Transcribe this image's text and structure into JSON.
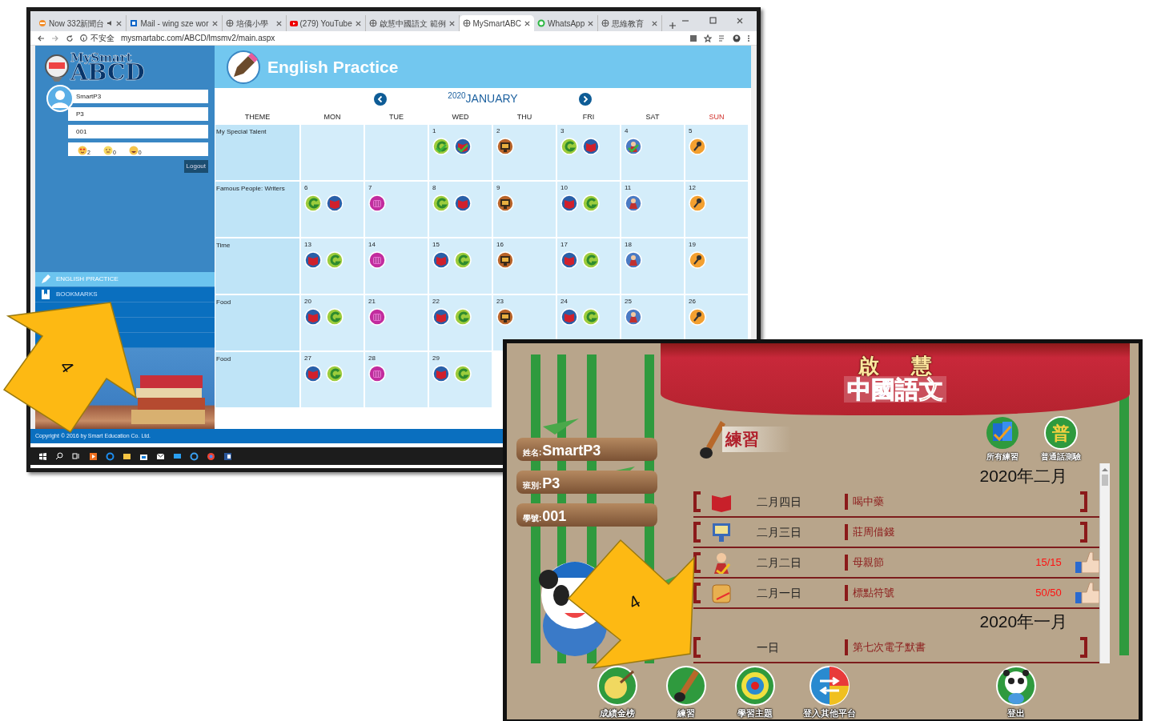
{
  "browser": {
    "tabs": [
      {
        "title": "Now 332新聞台",
        "kind": "news",
        "audio": true,
        "selected": false
      },
      {
        "title": "Mail - wing sze wor",
        "kind": "mail",
        "audio": false,
        "selected": false
      },
      {
        "title": "培僑小學",
        "kind": "globe",
        "audio": false,
        "selected": false
      },
      {
        "title": "(279) YouTube",
        "kind": "play",
        "audio": false,
        "selected": false
      },
      {
        "title": "啟慧中國語文 範例",
        "kind": "globe",
        "audio": false,
        "selected": false
      },
      {
        "title": "MySmartABC",
        "kind": "globe",
        "audio": false,
        "selected": true
      },
      {
        "title": "WhatsApp",
        "kind": "chat",
        "audio": false,
        "selected": false
      },
      {
        "title": "思維教育",
        "kind": "globe",
        "audio": false,
        "selected": false
      }
    ],
    "security": "不安全",
    "url": "mysmartabc.com/ABCD/lmsmv2/main.aspx"
  },
  "sidebar": {
    "logo": {
      "line1": "MySmart",
      "line2": "ABCD"
    },
    "fields": [
      "SmartP3",
      "P3",
      "001"
    ],
    "reactions": [
      {
        "kind": "love",
        "count": "2"
      },
      {
        "kind": "smile",
        "count": "0"
      },
      {
        "kind": "grin",
        "count": "0"
      }
    ],
    "logout": "Logout",
    "menu": [
      {
        "label": "ENGLISH PRACTICE",
        "kind": "pencil",
        "selected": true
      },
      {
        "label": "BOOKMARKS",
        "kind": "bookmark",
        "selected": false
      }
    ],
    "copyright": "Copyright © 2016 by Smart Education Co. Ltd."
  },
  "header": {
    "title": "English Practice"
  },
  "calendar": {
    "year": "2020",
    "month": "JANUARY",
    "columns": [
      {
        "label": "THEME",
        "highlighted": false
      },
      {
        "label": "MON",
        "highlighted": false
      },
      {
        "label": "TUE",
        "highlighted": false
      },
      {
        "label": "WED",
        "highlighted": false
      },
      {
        "label": "THU",
        "highlighted": false
      },
      {
        "label": "FRI",
        "highlighted": false
      },
      {
        "label": "SAT",
        "highlighted": false
      },
      {
        "label": "SUN",
        "highlighted": true
      }
    ],
    "rows": [
      {
        "theme": "My Special Talent",
        "days": [
          {
            "kind": "empty"
          },
          {
            "kind": "empty"
          },
          {
            "day": "1",
            "icons": [
              {
                "kind": "g",
                "done": true
              },
              {
                "kind": "book",
                "done": true
              }
            ]
          },
          {
            "day": "2",
            "icons": [
              {
                "kind": "monitor",
                "done": false
              }
            ]
          },
          {
            "day": "3",
            "icons": [
              {
                "kind": "g",
                "done": false
              },
              {
                "kind": "book",
                "done": false
              }
            ]
          },
          {
            "day": "4",
            "icons": [
              {
                "kind": "figure",
                "done": true
              }
            ]
          },
          {
            "day": "5",
            "icons": [
              {
                "kind": "key",
                "done": false
              }
            ]
          }
        ]
      },
      {
        "theme": "Famous People: Writers",
        "days": [
          {
            "day": "6",
            "icons": [
              {
                "kind": "g",
                "done": false
              },
              {
                "kind": "book",
                "done": false
              }
            ]
          },
          {
            "day": "7",
            "icons": [
              {
                "kind": "drum",
                "done": false
              }
            ]
          },
          {
            "day": "8",
            "icons": [
              {
                "kind": "g",
                "done": false
              },
              {
                "kind": "book",
                "done": false
              }
            ]
          },
          {
            "day": "9",
            "icons": [
              {
                "kind": "monitor",
                "done": false
              }
            ]
          },
          {
            "day": "10",
            "icons": [
              {
                "kind": "book",
                "done": false
              },
              {
                "kind": "g",
                "done": false
              }
            ]
          },
          {
            "day": "11",
            "icons": [
              {
                "kind": "figure",
                "done": false
              }
            ]
          },
          {
            "day": "12",
            "icons": [
              {
                "kind": "key",
                "done": false
              }
            ]
          }
        ]
      },
      {
        "theme": "Time",
        "days": [
          {
            "day": "13",
            "icons": [
              {
                "kind": "book",
                "done": false
              },
              {
                "kind": "g",
                "done": false
              }
            ]
          },
          {
            "day": "14",
            "icons": [
              {
                "kind": "drum",
                "done": false
              }
            ]
          },
          {
            "day": "15",
            "icons": [
              {
                "kind": "book",
                "done": false
              },
              {
                "kind": "g",
                "done": false
              }
            ]
          },
          {
            "day": "16",
            "icons": [
              {
                "kind": "monitor",
                "done": false
              }
            ]
          },
          {
            "day": "17",
            "icons": [
              {
                "kind": "book",
                "done": false
              },
              {
                "kind": "g",
                "done": false
              }
            ]
          },
          {
            "day": "18",
            "icons": [
              {
                "kind": "figure",
                "done": false
              }
            ]
          },
          {
            "day": "19",
            "icons": [
              {
                "kind": "key",
                "done": false
              }
            ]
          }
        ]
      },
      {
        "theme": "Food",
        "days": [
          {
            "day": "20",
            "icons": [
              {
                "kind": "book",
                "done": false
              },
              {
                "kind": "g",
                "done": false
              }
            ]
          },
          {
            "day": "21",
            "icons": [
              {
                "kind": "drum",
                "done": false
              }
            ]
          },
          {
            "day": "22",
            "icons": [
              {
                "kind": "book",
                "done": false
              },
              {
                "kind": "g",
                "done": false
              }
            ]
          },
          {
            "day": "23",
            "icons": [
              {
                "kind": "monitor",
                "done": false
              }
            ]
          },
          {
            "day": "24",
            "icons": [
              {
                "kind": "book",
                "done": false
              },
              {
                "kind": "g",
                "done": false
              }
            ]
          },
          {
            "day": "25",
            "icons": [
              {
                "kind": "figure",
                "done": false
              }
            ]
          },
          {
            "day": "26",
            "icons": [
              {
                "kind": "key",
                "done": false
              }
            ]
          }
        ]
      },
      {
        "theme": "Food",
        "days": [
          {
            "day": "27",
            "icons": [
              {
                "kind": "book",
                "done": false
              },
              {
                "kind": "g",
                "done": false
              }
            ]
          },
          {
            "day": "28",
            "icons": [
              {
                "kind": "drum",
                "done": false
              }
            ]
          },
          {
            "day": "29",
            "icons": [
              {
                "kind": "book",
                "done": false
              },
              {
                "kind": "g",
                "done": false
              }
            ]
          },
          {
            "kind": "covered"
          },
          {
            "kind": "covered"
          },
          {
            "kind": "covered"
          },
          {
            "kind": "covered"
          }
        ]
      }
    ]
  },
  "chinese_app": {
    "brand_top": [
      "啟",
      "慧"
    ],
    "brand_main": "中國語文",
    "student": [
      {
        "label": "姓名:",
        "value": "SmartP3"
      },
      {
        "label": "班別:",
        "value": "P3"
      },
      {
        "label": "學號:",
        "value": "001"
      }
    ],
    "section_title": "練習",
    "quick_links": [
      {
        "label": "所有練習",
        "kind": "books"
      },
      {
        "label": "普通話測驗",
        "kind": "glyph",
        "glyph": "普"
      }
    ],
    "months": [
      {
        "title": "2020年二月",
        "items": [
          {
            "kind": "book",
            "date": "二月四日",
            "title": "喝中藥",
            "liked": false
          },
          {
            "kind": "monitor",
            "date": "二月三日",
            "title": "莊周借錢",
            "liked": false
          },
          {
            "kind": "figure",
            "date": "二月二日",
            "title": "母親節",
            "score": "15/15",
            "liked": true
          },
          {
            "kind": "scroll",
            "date": "二月一日",
            "title": "標點符號",
            "score": "50/50",
            "liked": true
          }
        ]
      },
      {
        "title": "2020年一月",
        "items": [
          {
            "kind": "none",
            "date": "一日",
            "title": "第七次電子默書",
            "liked": false
          }
        ]
      }
    ],
    "nav": [
      {
        "label": "成績金榜",
        "kind": "gong"
      },
      {
        "label": "練習",
        "kind": "brush"
      },
      {
        "label": "學習主題",
        "kind": "target"
      },
      {
        "label": "登入其他平台",
        "kind": "arrows"
      },
      {
        "label": "登出",
        "kind": "panda"
      }
    ]
  },
  "annotations": [
    {
      "label": "4"
    },
    {
      "label": "4"
    }
  ]
}
